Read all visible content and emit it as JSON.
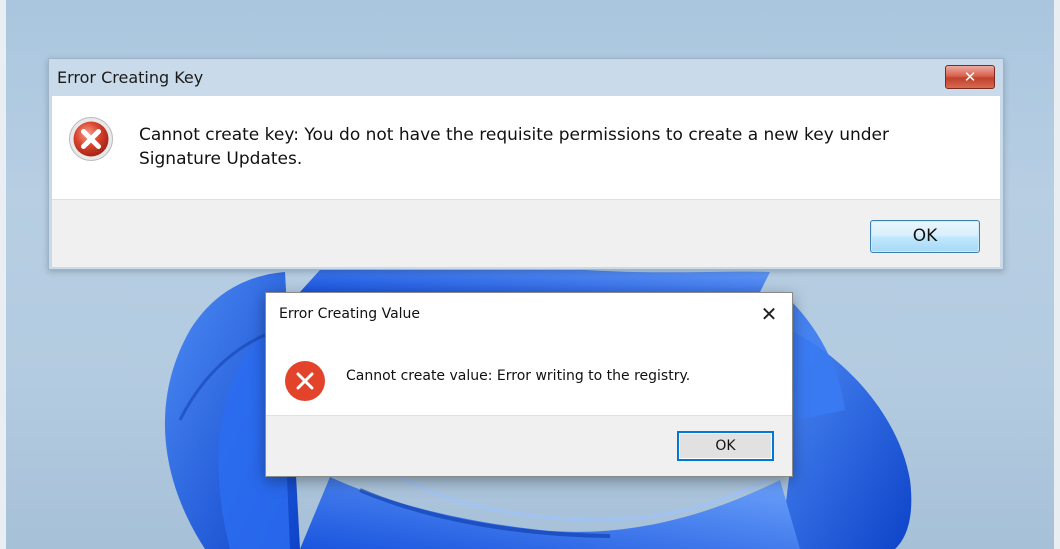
{
  "dialog_key": {
    "title": "Error Creating Key",
    "message": "Cannot create key: You do not have the requisite permissions to create a new key under Signature Updates.",
    "ok_label": "OK",
    "close_glyph": "✕",
    "icon": "error-icon"
  },
  "dialog_value": {
    "title": "Error Creating Value",
    "message": "Cannot create value: Error writing to the registry.",
    "ok_label": "OK",
    "close_glyph": "✕",
    "icon": "error-icon"
  },
  "colors": {
    "error_red": "#e2432a",
    "focus_blue": "#0078d7",
    "wallpaper_blue": "#1f5fe0"
  }
}
